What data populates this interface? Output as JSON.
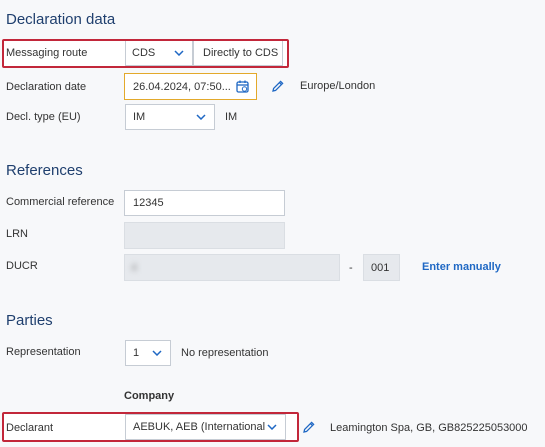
{
  "declaration": {
    "title": "Declaration data",
    "messaging_route": {
      "label": "Messaging route",
      "select_value": "CDS",
      "description": "Directly to CDS"
    },
    "declaration_date": {
      "label": "Declaration date",
      "value": "26.04.2024, 07:50...",
      "timezone": "Europe/London"
    },
    "decl_type": {
      "label": "Decl. type (EU)",
      "select_value": "IM",
      "description": "IM"
    }
  },
  "references": {
    "title": "References",
    "commercial_reference": {
      "label": "Commercial reference",
      "value": "12345"
    },
    "lrn": {
      "label": "LRN",
      "value": ""
    },
    "ducr": {
      "label": "DUCR",
      "value": "4",
      "separator": "-",
      "suffix": "001",
      "enter_manually": "Enter manually"
    }
  },
  "parties": {
    "title": "Parties",
    "representation": {
      "label": "Representation",
      "select_value": "1",
      "description": "No representation"
    },
    "column_header": "Company",
    "declarant": {
      "label": "Declarant",
      "select_value": "AEBUK, AEB (International) Li",
      "address": "Leamington Spa, GB, GB825225053000"
    }
  },
  "colors": {
    "section_title": "#1f3f6e",
    "accent": "#1f68c4",
    "highlight": "#c2273a",
    "focus_border": "#e3a92b"
  }
}
